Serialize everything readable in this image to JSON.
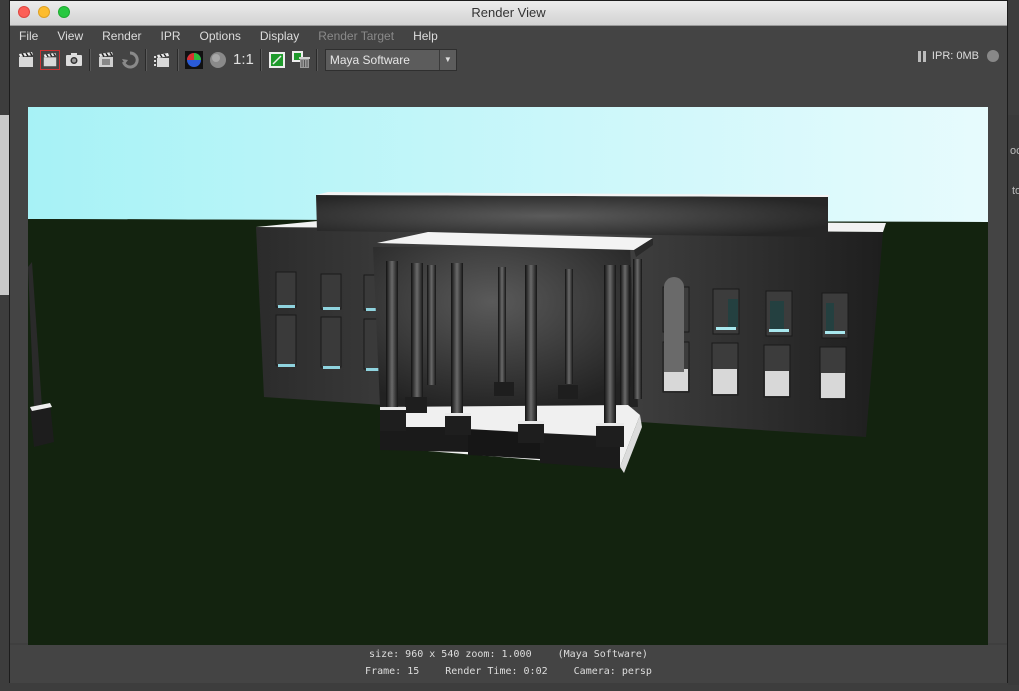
{
  "window": {
    "title": "Render View"
  },
  "menu": [
    "File",
    "View",
    "Render",
    "IPR",
    "Options",
    "Display",
    "Render Target",
    "Help"
  ],
  "toolbar": {
    "icons": [
      "render-frame-icon",
      "render-region-icon",
      "snapshot-icon",
      "ipr-render-icon",
      "refresh-ipr-icon",
      "render-sequence-icon",
      "rgb-channels-icon",
      "alpha-channel-icon",
      "real-size-icon",
      "keep-image-icon",
      "remove-image-icon"
    ],
    "real_size_label": "1:1",
    "renderer": "Maya Software",
    "ipr_memory": "IPR: 0MB"
  },
  "status": {
    "size": "size: 960 x 540 zoom: 1.000",
    "renderer": "(Maya Software)",
    "frame": "Frame: 15",
    "render_time": "Render Time: 0:02",
    "camera": "Camera: persp"
  },
  "background_app": {
    "right_labels": [
      "oc",
      "to"
    ]
  }
}
